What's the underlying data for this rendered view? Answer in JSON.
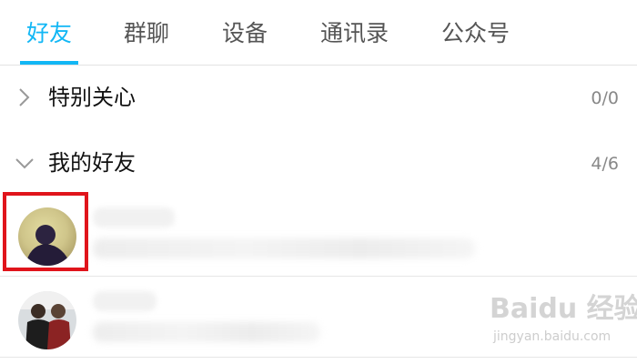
{
  "tabs": [
    {
      "label": "好友",
      "active": true
    },
    {
      "label": "群聊",
      "active": false
    },
    {
      "label": "设备",
      "active": false
    },
    {
      "label": "通讯录",
      "active": false
    },
    {
      "label": "公众号",
      "active": false
    }
  ],
  "groups": [
    {
      "title": "特别关心",
      "count": "0/0",
      "expanded": false
    },
    {
      "title": "我的好友",
      "count": "4/6",
      "expanded": true
    }
  ],
  "watermark": {
    "text": "Baidu 经验",
    "sub": "jingyan.baidu.com"
  },
  "colors": {
    "accent": "#12b7f5",
    "highlight": "#e0141b"
  },
  "icons": {
    "collapsed": "chevron-right-icon",
    "expanded": "chevron-down-icon"
  }
}
